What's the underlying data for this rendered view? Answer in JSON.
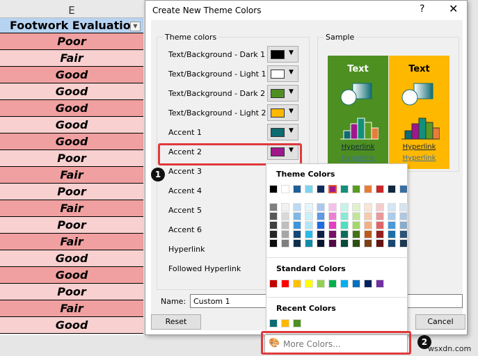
{
  "sheet": {
    "column": "E",
    "header": "Footwork Evaluation",
    "rows": [
      "Poor",
      "Fair",
      "Good",
      "Good",
      "Good",
      "Good",
      "Good",
      "Poor",
      "Fair",
      "Poor",
      "Fair",
      "Poor",
      "Fair",
      "Good",
      "Good",
      "Poor",
      "Fair",
      "Good"
    ],
    "row_colors": [
      "#f0a0a0",
      "#f8d0d0"
    ]
  },
  "dialog": {
    "title": "Create New Theme Colors",
    "help": "?",
    "close": "✕",
    "theme_group": "Theme colors",
    "items": [
      {
        "label": "Text/Background - Dark 1",
        "color": "#000000"
      },
      {
        "label": "Text/Background - Light 1",
        "color": "#ffffff"
      },
      {
        "label": "Text/Background - Dark 2",
        "color": "#4e8f22"
      },
      {
        "label": "Text/Background - Light 2",
        "color": "#ffb800"
      },
      {
        "label": "Accent 1",
        "color": "#0e6b72"
      },
      {
        "label": "Accent 2",
        "color": "#a0178a"
      },
      {
        "label": "Accent 3"
      },
      {
        "label": "Accent 4"
      },
      {
        "label": "Accent 5"
      },
      {
        "label": "Accent 6"
      },
      {
        "label": "Hyperlink"
      },
      {
        "label": "Followed Hyperlink"
      }
    ],
    "sample_group": "Sample",
    "sample_text": "Text",
    "sample_hyperlink": "Hyperlink",
    "sample_followed": "Hyperlink",
    "name_label": "Name:",
    "name_value": "Custom 1",
    "reset": "Reset",
    "cancel": "Cancel"
  },
  "palette": {
    "theme_header": "Theme Colors",
    "theme": [
      "#000000",
      "#ffffff",
      "#1f5f9a",
      "#7dd3f0",
      "#0f2d5c",
      "#a0178a",
      "#13907a",
      "#5a9a22",
      "#e77d3a",
      "#c82828",
      "#10273f",
      "#3b6fa0"
    ],
    "shades": [
      [
        "#7f7f7f",
        "#595959",
        "#3f3f3f",
        "#262626",
        "#0d0d0d"
      ],
      [
        "#f2f2f2",
        "#d9d9d9",
        "#bfbfbf",
        "#a6a6a6",
        "#7f7f7f"
      ],
      [
        "#bcdaf2",
        "#7fb7e6",
        "#3f95d9",
        "#174775",
        "#0f2f4e"
      ],
      [
        "#e5f6fc",
        "#cbeef9",
        "#b1e5f6",
        "#2bbbe6",
        "#148aa9"
      ],
      [
        "#a9c8f0",
        "#5f98e3",
        "#1e6ae0",
        "#0b2145",
        "#07162e"
      ],
      [
        "#f5c0ea",
        "#ec80d4",
        "#e33fbf",
        "#781167",
        "#500b45"
      ],
      [
        "#c4f4ea",
        "#89e9d5",
        "#4edfc0",
        "#0e6c5b",
        "#09483d"
      ],
      [
        "#e0f2cc",
        "#c1e59a",
        "#a2d867",
        "#437319",
        "#2d4d11"
      ],
      [
        "#fae4d6",
        "#f5cbae",
        "#f0b186",
        "#b95c1f",
        "#7b3e15"
      ],
      [
        "#f4cccc",
        "#e99999",
        "#de6666",
        "#961e1e",
        "#641414"
      ],
      [
        "#d5e5f5",
        "#abcbeb",
        "#4a9ad8",
        "#1c6da8",
        "#1a4770"
      ],
      [
        "#d7e3ee",
        "#b0c7dd",
        "#89abcc",
        "#2c5378",
        "#1d3750"
      ]
    ],
    "standard_header": "Standard Colors",
    "standard": [
      "#c00000",
      "#ff0000",
      "#ffc000",
      "#ffff00",
      "#92d050",
      "#00b050",
      "#00b0f0",
      "#0070c0",
      "#002060",
      "#7030a0"
    ],
    "recent_header": "Recent Colors",
    "recent": [
      "#0e6b72",
      "#ffb800",
      "#4e8f22"
    ],
    "more_colors": "More Colors..."
  },
  "annotations": {
    "badge1": "1",
    "badge2": "2",
    "accent": "#e0393c"
  },
  "watermark": "wsxdn.com"
}
